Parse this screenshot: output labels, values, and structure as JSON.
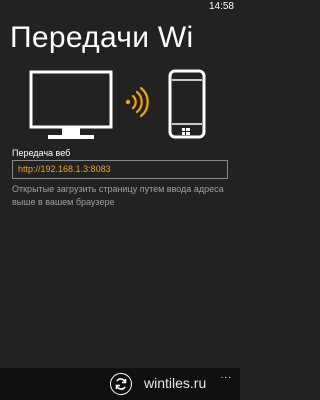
{
  "status_bar": {
    "time": "14:58"
  },
  "page": {
    "title": "Передачи Wi"
  },
  "illustration": {
    "monitor_icon": "monitor-icon",
    "signal_icon": "wifi-signal-icon",
    "phone_icon": "windows-phone-icon",
    "accent_color": "#f0a30a"
  },
  "transfer": {
    "label": "Передача веб",
    "url": "http://192.168.1.3:8083",
    "hint": "Открытые загрузить страницу путем ввода адреса выше в вашем браузере"
  },
  "app_bar": {
    "sync_icon": "sync-icon",
    "more": "...",
    "watermark": "wintiles.ru"
  },
  "colors": {
    "background": "#222222",
    "accent": "#f0a30a",
    "text": "#ffffff",
    "hint": "#a0a0a0"
  }
}
